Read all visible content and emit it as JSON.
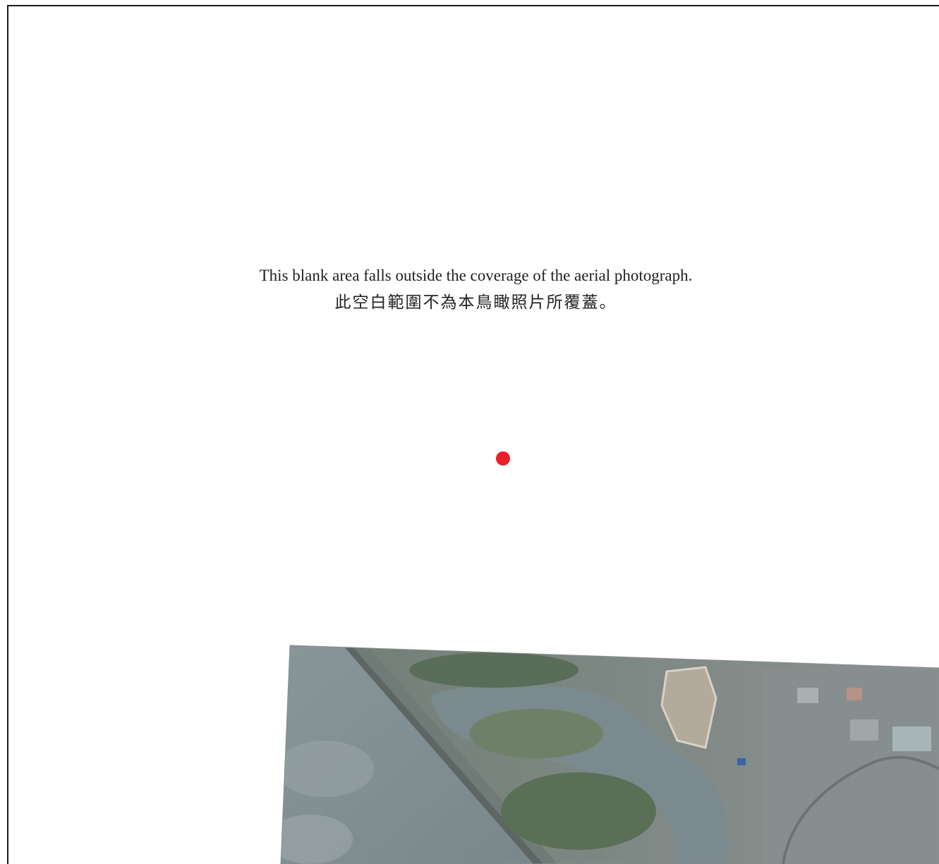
{
  "map": {
    "notice_en": "This blank area falls outside the coverage of the aerial photograph.",
    "notice_zh": "此空白範圍不為本鳥瞰照片所覆蓋。",
    "marker_color": "#e8202a",
    "aerial_photo_colors": {
      "water": "#7c8b90",
      "vegetation": "#5f7560",
      "land": "#8f8a83",
      "roofs": "#9aa6a8"
    }
  }
}
